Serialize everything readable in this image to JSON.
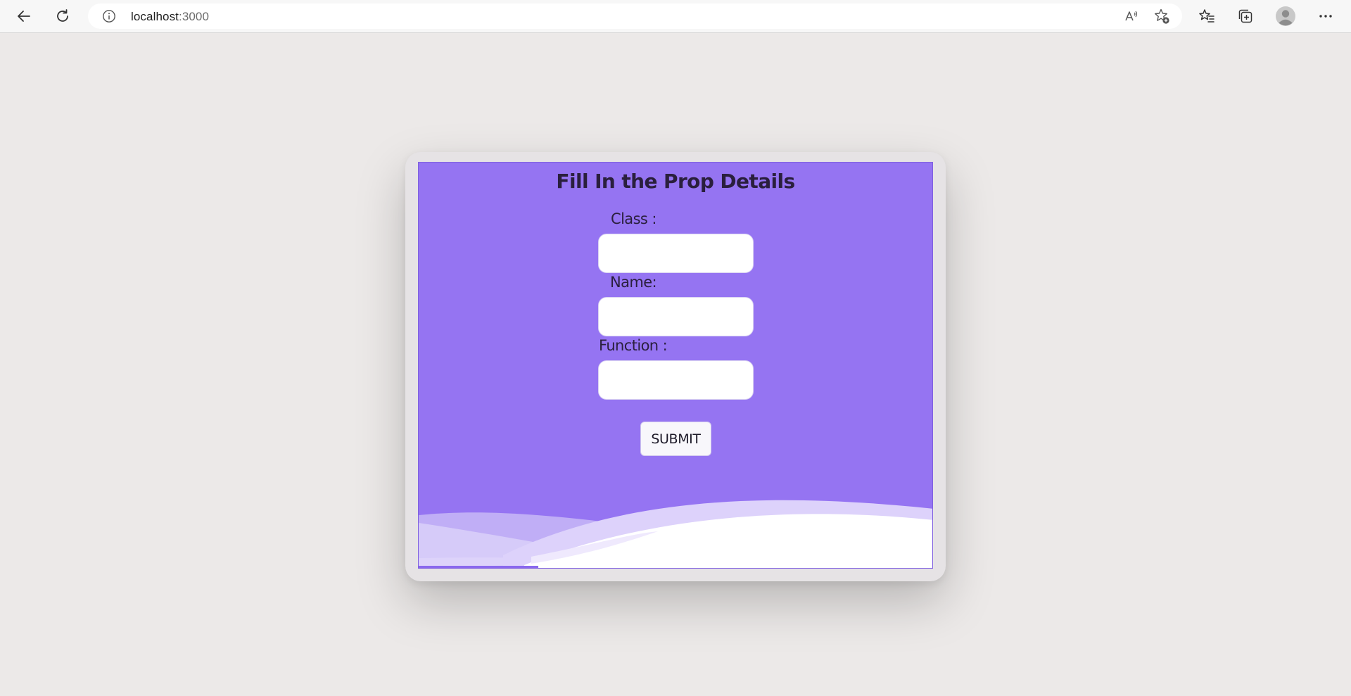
{
  "browser": {
    "url_host": "localhost",
    "url_port": ":3000",
    "icons": {
      "back": "arrow-left-icon",
      "reload": "reload-icon",
      "site_info": "info-icon",
      "read_aloud": "read-aloud-icon",
      "favorite": "add-favorite-icon",
      "favorites": "favorites-icon",
      "collections": "collections-icon",
      "profile": "profile-avatar-icon",
      "menu": "more-menu-icon"
    }
  },
  "form": {
    "title": "Fill In the Prop Details",
    "fields": [
      {
        "label": "Class :",
        "value": "",
        "placeholder": ""
      },
      {
        "label": "Name:",
        "value": "",
        "placeholder": ""
      },
      {
        "label": "Function :",
        "value": "",
        "placeholder": ""
      }
    ],
    "submit_label": "SUBMIT"
  },
  "colors": {
    "page_background": "#ece9e8",
    "card_background": "#9574f2",
    "wave_light": "#d3c6f8",
    "text_dark": "#2a1f3d"
  }
}
